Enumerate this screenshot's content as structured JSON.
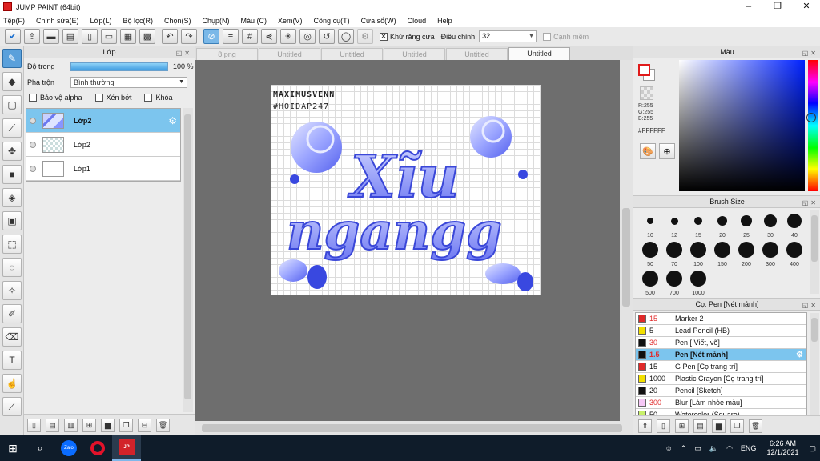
{
  "window": {
    "title": "JUMP PAINT (64bit)",
    "minimize_icon": "minimize-icon",
    "maximize_icon": "maximize-icon",
    "close_icon": "close-icon"
  },
  "menu": [
    "Tệp(F)",
    "Chỉnh sửa(E)",
    "Lớp(L)",
    "Bộ lọc(R)",
    "Chọn(S)",
    "Chụp(N)",
    "Màu (C)",
    "Xem(V)",
    "Công cụ(T)",
    "Cửa sổ(W)",
    "Cloud",
    "Help"
  ],
  "toolbar": {
    "antialias_label": "Khử răng cưa",
    "adjust_label": "Điều chỉnh",
    "adjust_value": "32",
    "smoothing_label": "Cạnh mềm"
  },
  "layer_panel": {
    "title": "Lớp",
    "opacity_label": "Độ trong",
    "opacity_value": "100 %",
    "opacity": 1.0,
    "blend_label": "Pha trộn",
    "blend_value": "Bình thường",
    "protect_alpha": "Bảo vệ alpha",
    "clip": "Xén bớt",
    "lock": "Khóa",
    "layers": [
      {
        "name": "Lớp2",
        "selected": true
      },
      {
        "name": "Lớp2",
        "selected": false
      },
      {
        "name": "Lớp1",
        "selected": false
      }
    ]
  },
  "tabs": [
    "8.png",
    "Untitled",
    "Untitled",
    "Untitled",
    "Untitled",
    "Untitled"
  ],
  "color_panel": {
    "title": "Màu",
    "r": "R:255",
    "g": "G:255",
    "b": "B:255",
    "hex": "#FFFFFF",
    "foreground": "#ffffff",
    "accent": "#e01a1a"
  },
  "brush_panel": {
    "title": "Brush Size",
    "sizes": [
      "10",
      "12",
      "15",
      "20",
      "25",
      "30",
      "40",
      "50",
      "70",
      "100",
      "150",
      "200",
      "300",
      "400",
      "500",
      "700",
      "1000"
    ]
  },
  "pen_panel": {
    "title": "Cọ: Pen [Nét mảnh]",
    "items": [
      {
        "size": "15",
        "name": "Marker 2",
        "color": "#e02a2a",
        "size_color": "#e02a2a"
      },
      {
        "size": "5",
        "name": "Lead Pencil (HB)",
        "color": "#f2e000",
        "size_color": "#111"
      },
      {
        "size": "30",
        "name": "Pen [ Viết, vẽ]",
        "color": "#111111",
        "size_color": "#e02a2a"
      },
      {
        "size": "1.5",
        "name": "Pen [Nét mảnh]",
        "color": "#111111",
        "size_color": "#e02a2a",
        "selected": true
      },
      {
        "size": "15",
        "name": "G Pen [Cọ trang trí]",
        "color": "#e02a2a",
        "size_color": "#111"
      },
      {
        "size": "1000",
        "name": "Plastic Crayon [Cọ trang trí]",
        "color": "#f2e000",
        "size_color": "#111"
      },
      {
        "size": "20",
        "name": "Pencil [Sketch]",
        "color": "#111111",
        "size_color": "#111"
      },
      {
        "size": "300",
        "name": "Blur [Làm nhòe màu]",
        "color": "#f6c8f6",
        "size_color": "#e02a2a"
      },
      {
        "size": "50",
        "name": "Watercolor (Square)",
        "color": "#c8f06a",
        "size_color": "#111"
      }
    ]
  },
  "canvas_art": {
    "line1": "MAXIMUSVENN",
    "line2": "#HOIDAP247",
    "title1": "Xĩu",
    "title2": "ngangg"
  },
  "taskbar": {
    "time": "6:26 AM",
    "date": "12/1/2021",
    "lang": "ENG",
    "zalo": "Zalo",
    "jump": "JUMP PAINT"
  }
}
